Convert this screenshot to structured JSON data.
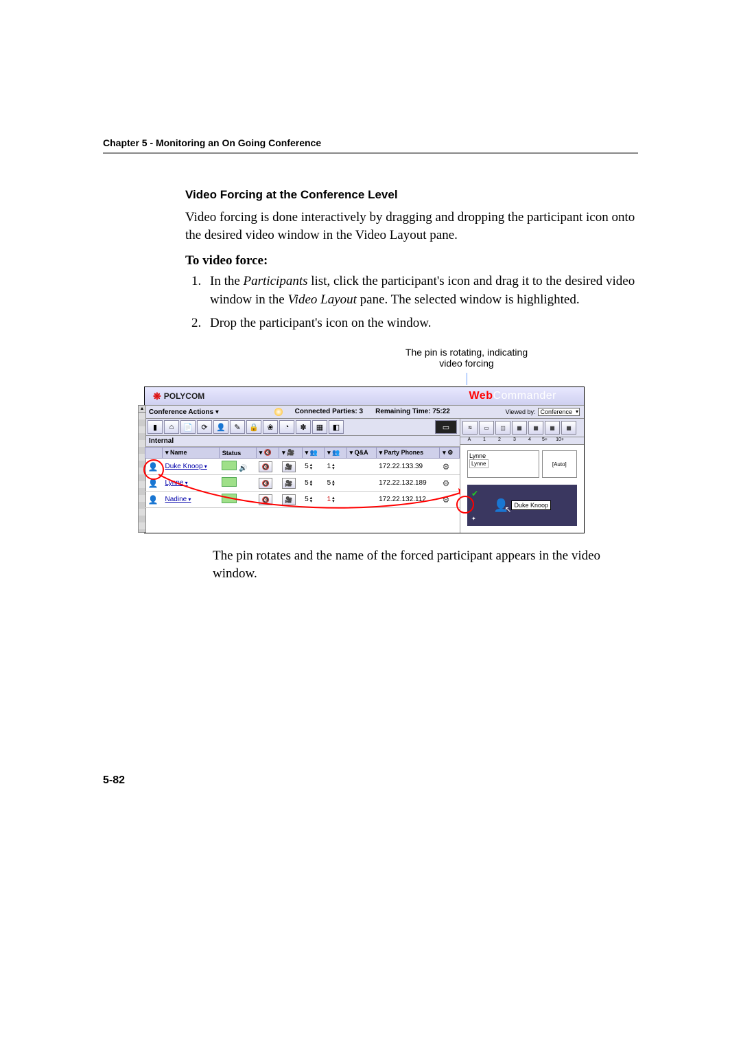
{
  "chapter_header": "Chapter 5 - Monitoring an On Going Conference",
  "section_title": "Video Forcing at the Conference Level",
  "intro": "Video forcing is done interactively by dragging and dropping the participant icon onto the desired video window in the Video Layout pane.",
  "subhead": "To video force:",
  "steps": [
    {
      "pre": "In the ",
      "em1": "Participants",
      "mid": " list, click the participant's icon and drag it to the desired video window in the ",
      "em2": "Video Layout",
      "post": " pane. The selected window is highlighted."
    },
    {
      "pre": "Drop the participant's icon on the window.",
      "em1": "",
      "mid": "",
      "em2": "",
      "post": ""
    }
  ],
  "callout": "The pin is rotating, indicating video forcing",
  "after_fig": "The pin rotates and the name of the forced participant appears in the video window.",
  "page_number": "5-82",
  "fig": {
    "logo_text": "POLYCOM",
    "brand_pre": "Web",
    "brand_post": "Commander",
    "conf_actions": "Conference Actions",
    "connected_parties": "Connected Parties: 3",
    "remaining_time": "Remaining Time: 75:22",
    "viewed_by_label": "Viewed by:",
    "viewed_by_value": "Conference",
    "group_label": "Internal",
    "columns": {
      "name": "Name",
      "status": "Status",
      "mute": "🔇",
      "cam": "📷",
      "a": "👥",
      "b": "👥",
      "qa": "Q&A",
      "phones": "Party Phones",
      "gear": "⚙"
    },
    "rows": [
      {
        "name": "Duke Knoop",
        "val1": "5",
        "val2": "1",
        "phone": "172.22.133.39"
      },
      {
        "name": "Lynne",
        "val1": "5",
        "val2": "5",
        "phone": "172.22.132.189"
      },
      {
        "name": "Nadine",
        "val1": "5",
        "val2": "1",
        "phone": "172.22.132.112"
      }
    ],
    "layout_labels": [
      "A",
      "1",
      "2",
      "3",
      "4",
      "5+",
      "10+"
    ],
    "preview_name": "Lynne",
    "preview_box": "Lynne",
    "preview_auto": "[Auto]",
    "drag_label": "Duke Knoop"
  }
}
